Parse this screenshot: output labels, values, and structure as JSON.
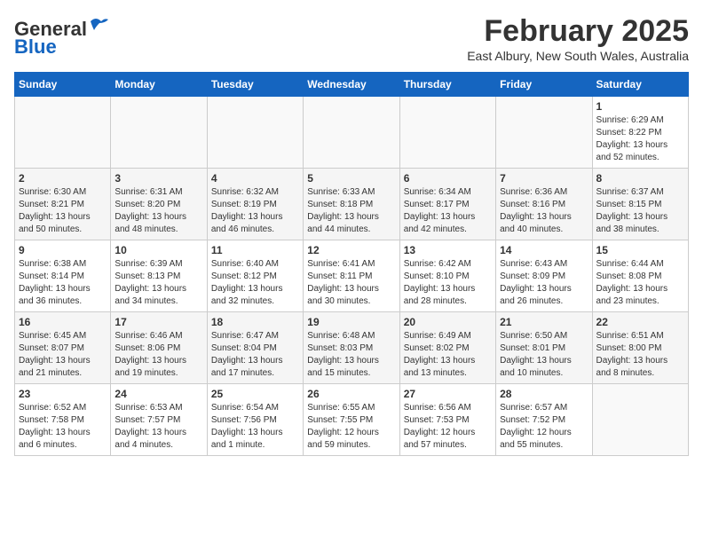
{
  "app": {
    "name": "GeneralBlue",
    "logo_general": "General",
    "logo_blue": "Blue"
  },
  "header": {
    "month_title": "February 2025",
    "location": "East Albury, New South Wales, Australia"
  },
  "weekdays": [
    "Sunday",
    "Monday",
    "Tuesday",
    "Wednesday",
    "Thursday",
    "Friday",
    "Saturday"
  ],
  "weeks": [
    [
      {
        "day": "",
        "info": ""
      },
      {
        "day": "",
        "info": ""
      },
      {
        "day": "",
        "info": ""
      },
      {
        "day": "",
        "info": ""
      },
      {
        "day": "",
        "info": ""
      },
      {
        "day": "",
        "info": ""
      },
      {
        "day": "1",
        "info": "Sunrise: 6:29 AM\nSunset: 8:22 PM\nDaylight: 13 hours\nand 52 minutes."
      }
    ],
    [
      {
        "day": "2",
        "info": "Sunrise: 6:30 AM\nSunset: 8:21 PM\nDaylight: 13 hours\nand 50 minutes."
      },
      {
        "day": "3",
        "info": "Sunrise: 6:31 AM\nSunset: 8:20 PM\nDaylight: 13 hours\nand 48 minutes."
      },
      {
        "day": "4",
        "info": "Sunrise: 6:32 AM\nSunset: 8:19 PM\nDaylight: 13 hours\nand 46 minutes."
      },
      {
        "day": "5",
        "info": "Sunrise: 6:33 AM\nSunset: 8:18 PM\nDaylight: 13 hours\nand 44 minutes."
      },
      {
        "day": "6",
        "info": "Sunrise: 6:34 AM\nSunset: 8:17 PM\nDaylight: 13 hours\nand 42 minutes."
      },
      {
        "day": "7",
        "info": "Sunrise: 6:36 AM\nSunset: 8:16 PM\nDaylight: 13 hours\nand 40 minutes."
      },
      {
        "day": "8",
        "info": "Sunrise: 6:37 AM\nSunset: 8:15 PM\nDaylight: 13 hours\nand 38 minutes."
      }
    ],
    [
      {
        "day": "9",
        "info": "Sunrise: 6:38 AM\nSunset: 8:14 PM\nDaylight: 13 hours\nand 36 minutes."
      },
      {
        "day": "10",
        "info": "Sunrise: 6:39 AM\nSunset: 8:13 PM\nDaylight: 13 hours\nand 34 minutes."
      },
      {
        "day": "11",
        "info": "Sunrise: 6:40 AM\nSunset: 8:12 PM\nDaylight: 13 hours\nand 32 minutes."
      },
      {
        "day": "12",
        "info": "Sunrise: 6:41 AM\nSunset: 8:11 PM\nDaylight: 13 hours\nand 30 minutes."
      },
      {
        "day": "13",
        "info": "Sunrise: 6:42 AM\nSunset: 8:10 PM\nDaylight: 13 hours\nand 28 minutes."
      },
      {
        "day": "14",
        "info": "Sunrise: 6:43 AM\nSunset: 8:09 PM\nDaylight: 13 hours\nand 26 minutes."
      },
      {
        "day": "15",
        "info": "Sunrise: 6:44 AM\nSunset: 8:08 PM\nDaylight: 13 hours\nand 23 minutes."
      }
    ],
    [
      {
        "day": "16",
        "info": "Sunrise: 6:45 AM\nSunset: 8:07 PM\nDaylight: 13 hours\nand 21 minutes."
      },
      {
        "day": "17",
        "info": "Sunrise: 6:46 AM\nSunset: 8:06 PM\nDaylight: 13 hours\nand 19 minutes."
      },
      {
        "day": "18",
        "info": "Sunrise: 6:47 AM\nSunset: 8:04 PM\nDaylight: 13 hours\nand 17 minutes."
      },
      {
        "day": "19",
        "info": "Sunrise: 6:48 AM\nSunset: 8:03 PM\nDaylight: 13 hours\nand 15 minutes."
      },
      {
        "day": "20",
        "info": "Sunrise: 6:49 AM\nSunset: 8:02 PM\nDaylight: 13 hours\nand 13 minutes."
      },
      {
        "day": "21",
        "info": "Sunrise: 6:50 AM\nSunset: 8:01 PM\nDaylight: 13 hours\nand 10 minutes."
      },
      {
        "day": "22",
        "info": "Sunrise: 6:51 AM\nSunset: 8:00 PM\nDaylight: 13 hours\nand 8 minutes."
      }
    ],
    [
      {
        "day": "23",
        "info": "Sunrise: 6:52 AM\nSunset: 7:58 PM\nDaylight: 13 hours\nand 6 minutes."
      },
      {
        "day": "24",
        "info": "Sunrise: 6:53 AM\nSunset: 7:57 PM\nDaylight: 13 hours\nand 4 minutes."
      },
      {
        "day": "25",
        "info": "Sunrise: 6:54 AM\nSunset: 7:56 PM\nDaylight: 13 hours\nand 1 minute."
      },
      {
        "day": "26",
        "info": "Sunrise: 6:55 AM\nSunset: 7:55 PM\nDaylight: 12 hours\nand 59 minutes."
      },
      {
        "day": "27",
        "info": "Sunrise: 6:56 AM\nSunset: 7:53 PM\nDaylight: 12 hours\nand 57 minutes."
      },
      {
        "day": "28",
        "info": "Sunrise: 6:57 AM\nSunset: 7:52 PM\nDaylight: 12 hours\nand 55 minutes."
      },
      {
        "day": "",
        "info": ""
      }
    ]
  ]
}
